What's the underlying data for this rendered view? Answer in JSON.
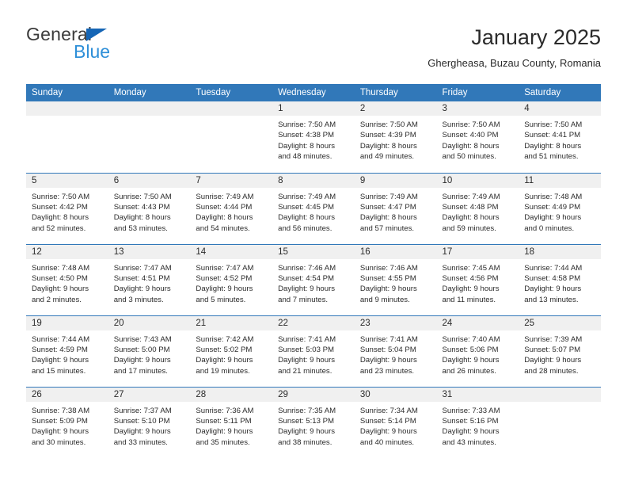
{
  "brand": {
    "name_part1": "General",
    "name_part2": "Blue",
    "triangle_color": "#1565b5",
    "blue_color": "#2e8fd8"
  },
  "header": {
    "month_title": "January 2025",
    "location": "Ghergheasa, Buzau County, Romania"
  },
  "calendar": {
    "header_bg": "#3178b9",
    "daynum_bg": "#f0f0f0",
    "weekday_headers": [
      "Sunday",
      "Monday",
      "Tuesday",
      "Wednesday",
      "Thursday",
      "Friday",
      "Saturday"
    ],
    "weeks": [
      [
        {
          "day": "",
          "sunrise": "",
          "sunset": "",
          "daylight_line1": "",
          "daylight_line2": ""
        },
        {
          "day": "",
          "sunrise": "",
          "sunset": "",
          "daylight_line1": "",
          "daylight_line2": ""
        },
        {
          "day": "",
          "sunrise": "",
          "sunset": "",
          "daylight_line1": "",
          "daylight_line2": ""
        },
        {
          "day": "1",
          "sunrise": "Sunrise: 7:50 AM",
          "sunset": "Sunset: 4:38 PM",
          "daylight_line1": "Daylight: 8 hours",
          "daylight_line2": "and 48 minutes."
        },
        {
          "day": "2",
          "sunrise": "Sunrise: 7:50 AM",
          "sunset": "Sunset: 4:39 PM",
          "daylight_line1": "Daylight: 8 hours",
          "daylight_line2": "and 49 minutes."
        },
        {
          "day": "3",
          "sunrise": "Sunrise: 7:50 AM",
          "sunset": "Sunset: 4:40 PM",
          "daylight_line1": "Daylight: 8 hours",
          "daylight_line2": "and 50 minutes."
        },
        {
          "day": "4",
          "sunrise": "Sunrise: 7:50 AM",
          "sunset": "Sunset: 4:41 PM",
          "daylight_line1": "Daylight: 8 hours",
          "daylight_line2": "and 51 minutes."
        }
      ],
      [
        {
          "day": "5",
          "sunrise": "Sunrise: 7:50 AM",
          "sunset": "Sunset: 4:42 PM",
          "daylight_line1": "Daylight: 8 hours",
          "daylight_line2": "and 52 minutes."
        },
        {
          "day": "6",
          "sunrise": "Sunrise: 7:50 AM",
          "sunset": "Sunset: 4:43 PM",
          "daylight_line1": "Daylight: 8 hours",
          "daylight_line2": "and 53 minutes."
        },
        {
          "day": "7",
          "sunrise": "Sunrise: 7:49 AM",
          "sunset": "Sunset: 4:44 PM",
          "daylight_line1": "Daylight: 8 hours",
          "daylight_line2": "and 54 minutes."
        },
        {
          "day": "8",
          "sunrise": "Sunrise: 7:49 AM",
          "sunset": "Sunset: 4:45 PM",
          "daylight_line1": "Daylight: 8 hours",
          "daylight_line2": "and 56 minutes."
        },
        {
          "day": "9",
          "sunrise": "Sunrise: 7:49 AM",
          "sunset": "Sunset: 4:47 PM",
          "daylight_line1": "Daylight: 8 hours",
          "daylight_line2": "and 57 minutes."
        },
        {
          "day": "10",
          "sunrise": "Sunrise: 7:49 AM",
          "sunset": "Sunset: 4:48 PM",
          "daylight_line1": "Daylight: 8 hours",
          "daylight_line2": "and 59 minutes."
        },
        {
          "day": "11",
          "sunrise": "Sunrise: 7:48 AM",
          "sunset": "Sunset: 4:49 PM",
          "daylight_line1": "Daylight: 9 hours",
          "daylight_line2": "and 0 minutes."
        }
      ],
      [
        {
          "day": "12",
          "sunrise": "Sunrise: 7:48 AM",
          "sunset": "Sunset: 4:50 PM",
          "daylight_line1": "Daylight: 9 hours",
          "daylight_line2": "and 2 minutes."
        },
        {
          "day": "13",
          "sunrise": "Sunrise: 7:47 AM",
          "sunset": "Sunset: 4:51 PM",
          "daylight_line1": "Daylight: 9 hours",
          "daylight_line2": "and 3 minutes."
        },
        {
          "day": "14",
          "sunrise": "Sunrise: 7:47 AM",
          "sunset": "Sunset: 4:52 PM",
          "daylight_line1": "Daylight: 9 hours",
          "daylight_line2": "and 5 minutes."
        },
        {
          "day": "15",
          "sunrise": "Sunrise: 7:46 AM",
          "sunset": "Sunset: 4:54 PM",
          "daylight_line1": "Daylight: 9 hours",
          "daylight_line2": "and 7 minutes."
        },
        {
          "day": "16",
          "sunrise": "Sunrise: 7:46 AM",
          "sunset": "Sunset: 4:55 PM",
          "daylight_line1": "Daylight: 9 hours",
          "daylight_line2": "and 9 minutes."
        },
        {
          "day": "17",
          "sunrise": "Sunrise: 7:45 AM",
          "sunset": "Sunset: 4:56 PM",
          "daylight_line1": "Daylight: 9 hours",
          "daylight_line2": "and 11 minutes."
        },
        {
          "day": "18",
          "sunrise": "Sunrise: 7:44 AM",
          "sunset": "Sunset: 4:58 PM",
          "daylight_line1": "Daylight: 9 hours",
          "daylight_line2": "and 13 minutes."
        }
      ],
      [
        {
          "day": "19",
          "sunrise": "Sunrise: 7:44 AM",
          "sunset": "Sunset: 4:59 PM",
          "daylight_line1": "Daylight: 9 hours",
          "daylight_line2": "and 15 minutes."
        },
        {
          "day": "20",
          "sunrise": "Sunrise: 7:43 AM",
          "sunset": "Sunset: 5:00 PM",
          "daylight_line1": "Daylight: 9 hours",
          "daylight_line2": "and 17 minutes."
        },
        {
          "day": "21",
          "sunrise": "Sunrise: 7:42 AM",
          "sunset": "Sunset: 5:02 PM",
          "daylight_line1": "Daylight: 9 hours",
          "daylight_line2": "and 19 minutes."
        },
        {
          "day": "22",
          "sunrise": "Sunrise: 7:41 AM",
          "sunset": "Sunset: 5:03 PM",
          "daylight_line1": "Daylight: 9 hours",
          "daylight_line2": "and 21 minutes."
        },
        {
          "day": "23",
          "sunrise": "Sunrise: 7:41 AM",
          "sunset": "Sunset: 5:04 PM",
          "daylight_line1": "Daylight: 9 hours",
          "daylight_line2": "and 23 minutes."
        },
        {
          "day": "24",
          "sunrise": "Sunrise: 7:40 AM",
          "sunset": "Sunset: 5:06 PM",
          "daylight_line1": "Daylight: 9 hours",
          "daylight_line2": "and 26 minutes."
        },
        {
          "day": "25",
          "sunrise": "Sunrise: 7:39 AM",
          "sunset": "Sunset: 5:07 PM",
          "daylight_line1": "Daylight: 9 hours",
          "daylight_line2": "and 28 minutes."
        }
      ],
      [
        {
          "day": "26",
          "sunrise": "Sunrise: 7:38 AM",
          "sunset": "Sunset: 5:09 PM",
          "daylight_line1": "Daylight: 9 hours",
          "daylight_line2": "and 30 minutes."
        },
        {
          "day": "27",
          "sunrise": "Sunrise: 7:37 AM",
          "sunset": "Sunset: 5:10 PM",
          "daylight_line1": "Daylight: 9 hours",
          "daylight_line2": "and 33 minutes."
        },
        {
          "day": "28",
          "sunrise": "Sunrise: 7:36 AM",
          "sunset": "Sunset: 5:11 PM",
          "daylight_line1": "Daylight: 9 hours",
          "daylight_line2": "and 35 minutes."
        },
        {
          "day": "29",
          "sunrise": "Sunrise: 7:35 AM",
          "sunset": "Sunset: 5:13 PM",
          "daylight_line1": "Daylight: 9 hours",
          "daylight_line2": "and 38 minutes."
        },
        {
          "day": "30",
          "sunrise": "Sunrise: 7:34 AM",
          "sunset": "Sunset: 5:14 PM",
          "daylight_line1": "Daylight: 9 hours",
          "daylight_line2": "and 40 minutes."
        },
        {
          "day": "31",
          "sunrise": "Sunrise: 7:33 AM",
          "sunset": "Sunset: 5:16 PM",
          "daylight_line1": "Daylight: 9 hours",
          "daylight_line2": "and 43 minutes."
        },
        {
          "day": "",
          "sunrise": "",
          "sunset": "",
          "daylight_line1": "",
          "daylight_line2": ""
        }
      ]
    ]
  }
}
